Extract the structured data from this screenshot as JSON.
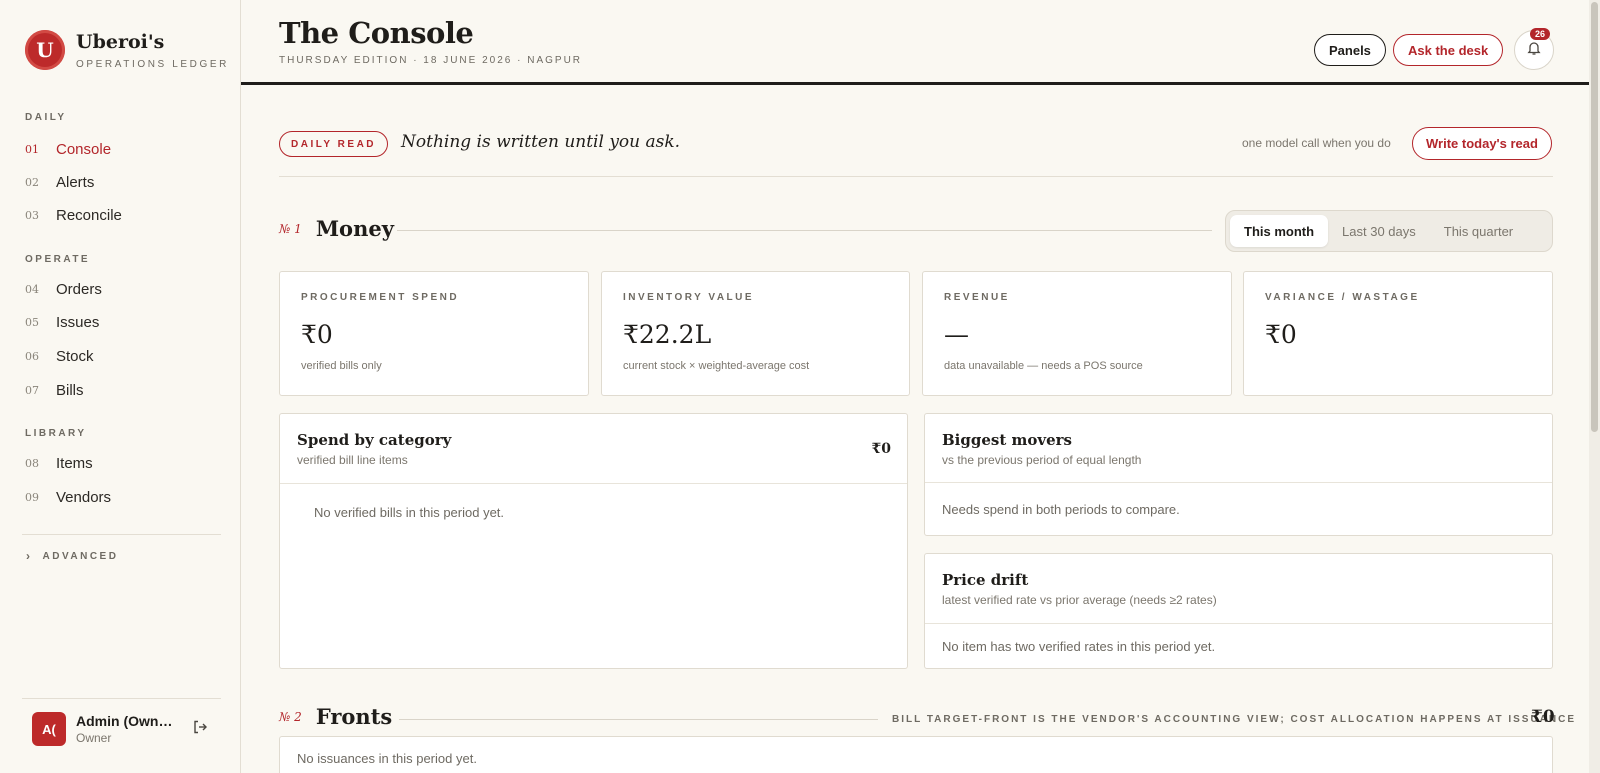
{
  "brand": {
    "logo_letter": "U",
    "name": "Uberoi's",
    "subtitle": "OPERATIONS LEDGER"
  },
  "nav": {
    "sections": [
      {
        "label": "DAILY",
        "items": [
          {
            "num": "01",
            "label": "Console",
            "active": true
          },
          {
            "num": "02",
            "label": "Alerts"
          },
          {
            "num": "03",
            "label": "Reconcile"
          }
        ]
      },
      {
        "label": "OPERATE",
        "items": [
          {
            "num": "04",
            "label": "Orders"
          },
          {
            "num": "05",
            "label": "Issues"
          },
          {
            "num": "06",
            "label": "Stock"
          },
          {
            "num": "07",
            "label": "Bills"
          }
        ]
      },
      {
        "label": "LIBRARY",
        "items": [
          {
            "num": "08",
            "label": "Items"
          },
          {
            "num": "09",
            "label": "Vendors"
          }
        ]
      }
    ],
    "advanced_label": "ADVANCED"
  },
  "user": {
    "initials": "A(",
    "name": "Admin (Owner)",
    "role": "Owner"
  },
  "header": {
    "title": "The Console",
    "edition": "THURSDAY EDITION · 18 JUNE 2026 · NAGPUR",
    "panels_label": "Panels",
    "ask_label": "Ask the desk",
    "notifications_count": "26"
  },
  "daily_read": {
    "tag": "DAILY READ",
    "quote": "Nothing is written until you ask.",
    "hint": "one model call when you do",
    "button": "Write today's read"
  },
  "money": {
    "num": "№ 1",
    "title": "Money",
    "periods": [
      "This month",
      "Last 30 days",
      "This quarter"
    ],
    "selected_period": "This month",
    "kpis": [
      {
        "label": "PROCUREMENT SPEND",
        "value": "₹0",
        "note": "verified bills only"
      },
      {
        "label": "INVENTORY VALUE",
        "value": "₹22.2L",
        "note": "current stock × weighted-average cost"
      },
      {
        "label": "REVENUE",
        "value": "—",
        "note": "data unavailable — needs a POS source"
      },
      {
        "label": "VARIANCE / WASTAGE",
        "value": "₹0",
        "note": ""
      }
    ],
    "spend_by_category": {
      "title": "Spend by category",
      "subtitle": "verified bill line items",
      "amount": "₹0",
      "empty": "No verified bills in this period yet."
    },
    "biggest_movers": {
      "title": "Biggest movers",
      "subtitle": "vs the previous period of equal length",
      "empty": "Needs spend in both periods to compare."
    },
    "price_drift": {
      "title": "Price drift",
      "subtitle": "latest verified rate vs prior average (needs ≥2 rates)",
      "empty": "No item has two verified rates in this period yet."
    }
  },
  "fronts": {
    "num": "№ 2",
    "title": "Fronts",
    "note": "BILL TARGET-FRONT IS THE VENDOR'S ACCOUNTING VIEW; COST ALLOCATION HAPPENS AT ISSUANCE",
    "amount": "₹0",
    "empty": "No issuances in this period yet."
  },
  "colors": {
    "accent": "#b3262b",
    "background": "#faf8f2",
    "ink": "#1f1d1a"
  }
}
